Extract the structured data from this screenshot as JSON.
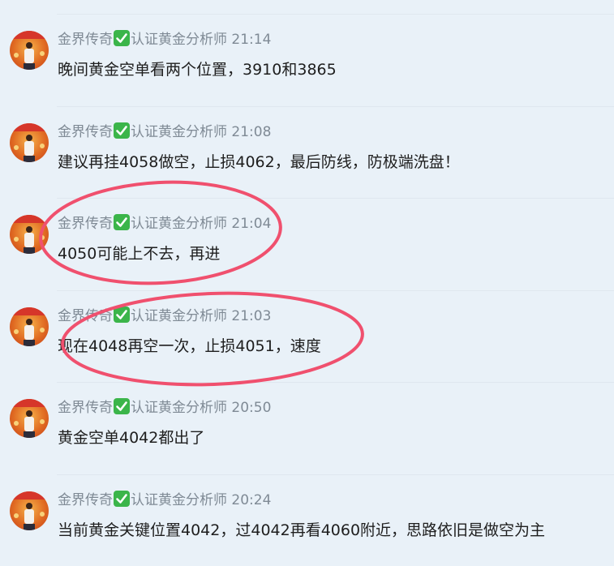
{
  "messages": [
    {
      "author": "金界传奇",
      "title": "认证黄金分析师",
      "time": "21:14",
      "text": "晚间黄金空单看两个位置，3910和3865"
    },
    {
      "author": "金界传奇",
      "title": "认证黄金分析师",
      "time": "21:08",
      "text": "建议再挂4058做空，止损4062，最后防线，防极端洗盘！"
    },
    {
      "author": "金界传奇",
      "title": "认证黄金分析师",
      "time": "21:04",
      "text": "4050可能上不去，再进"
    },
    {
      "author": "金界传奇",
      "title": "认证黄金分析师",
      "time": "21:03",
      "text": "现在4048再空一次，止损4051，速度"
    },
    {
      "author": "金界传奇",
      "title": "认证黄金分析师",
      "time": "20:50",
      "text": "黄金空单4042都出了"
    },
    {
      "author": "金界传奇",
      "title": "认证黄金分析师",
      "time": "20:24",
      "text": "当前黄金关键位置4042，过4042再看4060附近，思路依旧是做空为主"
    }
  ],
  "icons": {
    "verified": "check-mark-badge-icon",
    "avatar": "profile-photo"
  },
  "colors": {
    "background": "#e9f1f8",
    "meta_text": "#7f8a95",
    "message_text": "#1e1e1e",
    "verified_badge": "#3bb54a",
    "annotation_circle": "#f0506e"
  }
}
